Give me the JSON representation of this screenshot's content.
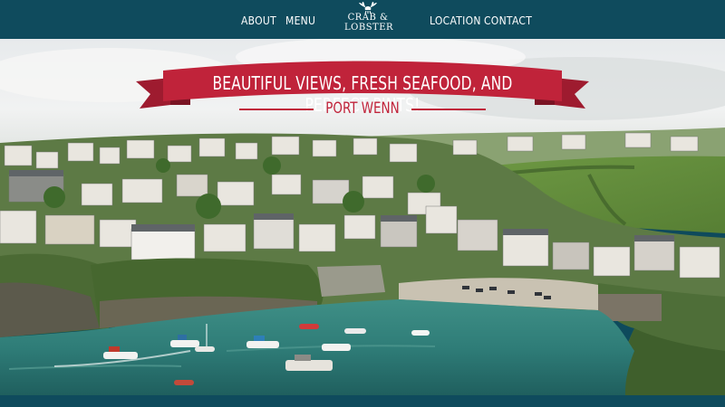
{
  "nav": {
    "about": "ABOUT",
    "menu": "MENU",
    "location": "LOCATION",
    "contact": "CONTACT"
  },
  "logo": {
    "line1": "CRAB &",
    "line2": "LOBSTER",
    "icon": "lobster-icon"
  },
  "hero": {
    "tagline": "BEAUTIFUL VIEWS, FRESH SEAFOOD, AND PERFECT PINTS!",
    "location": "PORT WENN",
    "image": "harbour-village-photo"
  },
  "colors": {
    "nav_bg": "#0f4b5d",
    "ribbon_red": "#c0233a",
    "text_white": "#ffffff"
  }
}
